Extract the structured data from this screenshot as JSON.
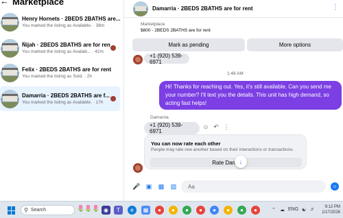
{
  "left_pane": {
    "title": "Marketplace",
    "conversations": [
      {
        "name": "Henry Hornets · 2BEDS 2BATHS are...",
        "sub": "You marked the listing as Available. · 38m"
      },
      {
        "name": "Ñijah · 2BEDS 2BATHS are for rent",
        "sub": "You marked the listing as Availab... · 42m"
      },
      {
        "name": "Felix · 2BEDS 2BATHS are for rent",
        "sub": "You marked the listing as Sold. · 2h"
      },
      {
        "name": "Damarria · 2BEDS 2BATHS are f...",
        "sub": "You marked the listing as Available. · 17h"
      }
    ]
  },
  "chat": {
    "header_title": "Damarria · 2BEDS 2BATHS are for rent",
    "listing_label": "Marketplace",
    "listing_price": "$800 - 2BEDS 2BATHS are for rent",
    "buttons": {
      "mark_pending": "Mark as pending",
      "more_options": "More options"
    },
    "phone_msg_1": "+1 (920) 539-6971",
    "timestamp": "1:48 AM",
    "outgoing_msg": "Hi! Thanks for reaching out. Yes, it's still available. Can you send me your number? I'll text you the details. This unit has high demand, so acting fast helps!",
    "sender_name": "Damarria",
    "phone_msg_2": "+1 (920) 539-6971",
    "rate_card": {
      "title": "You can now rate each other",
      "subtitle": "People may rate one another based on their interactions or transactions.",
      "button": "Rate Dama"
    },
    "compose_placeholder": "Aa"
  },
  "taskbar": {
    "search_label": "Search",
    "lang": "ENG",
    "time": "9:12 PM",
    "date": "1/17/2026"
  },
  "colors": {
    "outgoing_bubble": "#7b3fe4",
    "accent": "#1877f2",
    "selected_conv": "#e7f3ff"
  }
}
